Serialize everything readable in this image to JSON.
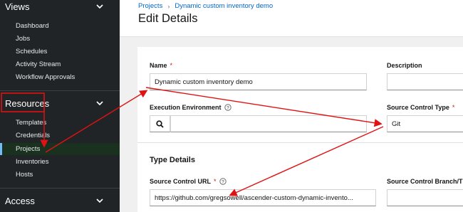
{
  "sidebar": {
    "views_label": "Views",
    "views_items": [
      "Dashboard",
      "Jobs",
      "Schedules",
      "Activity Stream",
      "Workflow Approvals"
    ],
    "resources_label": "Resources",
    "resources_items": [
      "Templates",
      "Credentials",
      "Projects",
      "Inventories",
      "Hosts"
    ],
    "access_label": "Access"
  },
  "breadcrumb": {
    "parent": "Projects",
    "current": "Dynamic custom inventory demo"
  },
  "page_title": "Edit Details",
  "form": {
    "name_label": "Name",
    "name_value": "Dynamic custom inventory demo",
    "description_label": "Description",
    "description_value": "",
    "exec_env_label": "Execution Environment",
    "exec_env_value": "",
    "scm_type_label": "Source Control Type",
    "scm_type_value": "Git",
    "type_details_title": "Type Details",
    "scm_url_label": "Source Control URL",
    "scm_url_value": "https://github.com/gregsowell/ascender-custom-dynamic-invento...",
    "scm_branch_label": "Source Control Branch/T",
    "scm_branch_value": "",
    "required_mark": "*"
  },
  "colors": {
    "annotation": "#e01212",
    "link": "#0066cc",
    "sidebar_bg": "#212427",
    "active_border": "#73bcf7"
  }
}
